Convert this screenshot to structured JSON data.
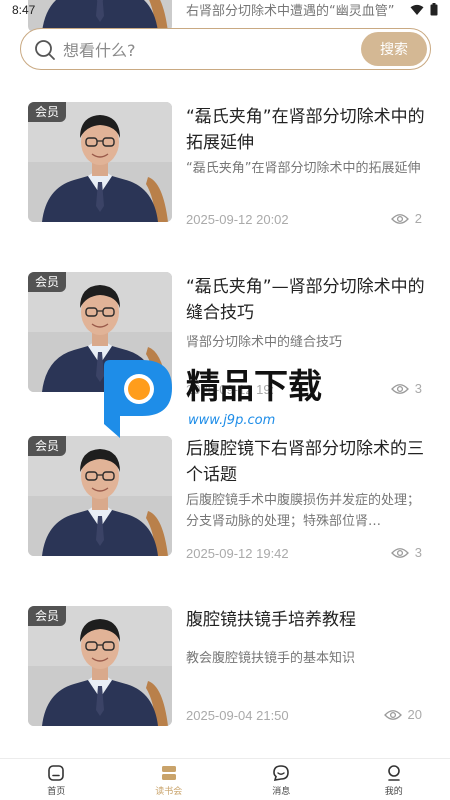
{
  "status_bar": {
    "time": "8:47"
  },
  "peek_item": {
    "desc": "右肾部分切除术中遭遇的“幽灵血管”"
  },
  "search": {
    "placeholder": "想看什么?",
    "button_label": "搜索"
  },
  "items": [
    {
      "badge": "会员",
      "title": "“磊氏夹角”在肾部分切除术中的拓展延伸",
      "desc": "“磊氏夹角”在肾部分切除术中的拓展延伸",
      "date": "2025-09-12 20:02",
      "views": "2"
    },
    {
      "badge": "会员",
      "title": "“磊氏夹角”—肾部分切除术中的缝合技巧",
      "desc": "肾部分切除术中的缝合技巧",
      "date": "2025-09-12 19:",
      "views": "3"
    },
    {
      "badge": "会员",
      "title": "后腹腔镜下右肾部分切除术的三个话题",
      "desc": "后腹腔镜手术中腹膜损伤并发症的处理；分支肾动脉的处理；特殊部位肾…",
      "date": "2025-09-12 19:42",
      "views": "3"
    },
    {
      "badge": "会员",
      "title": "腹腔镜扶镜手培养教程",
      "desc": "教会腹腔镜扶镜手的基本知识",
      "date": "2025-09-04 21:50",
      "views": "20"
    }
  ],
  "watermark": {
    "title": "精品下载",
    "url": "www.j9p.com"
  },
  "nav": {
    "home": "首页",
    "book_club": "读书会",
    "messages": "消息",
    "mine": "我的",
    "active": "book_club"
  },
  "colors": {
    "accent": "#c9a36a",
    "search_button": "#d4b894",
    "search_border": "#c9a982",
    "suit": "#2b3556"
  }
}
